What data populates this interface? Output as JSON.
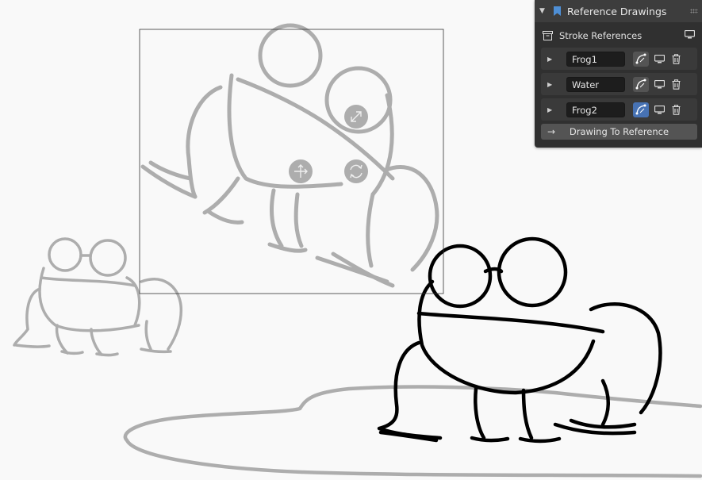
{
  "panel": {
    "title": "Reference Drawings",
    "section_title": "Stroke References",
    "references": [
      {
        "name": "Frog1",
        "active": false
      },
      {
        "name": "Water",
        "active": false
      },
      {
        "name": "Frog2",
        "active": true
      }
    ],
    "action_button": "Drawing To Reference"
  },
  "colors": {
    "panel_bg": "#303030",
    "panel_header": "#3d3d3d",
    "accent_active": "#4772b3",
    "canvas_bg": "#f9f9f9",
    "reference_stroke": "#adadad",
    "drawing_stroke": "#000000"
  },
  "icons": {
    "panel_collapse": "triangle-down-icon",
    "panel_bookmark": "bookmark-icon",
    "section": "archive-box-icon",
    "visibility": "monitor-icon",
    "delete": "trash-icon",
    "curve": "curve-edit-icon",
    "gizmo_move": "move-arrows-icon",
    "gizmo_rotate": "rotate-icon",
    "gizmo_scale": "scale-icon"
  }
}
